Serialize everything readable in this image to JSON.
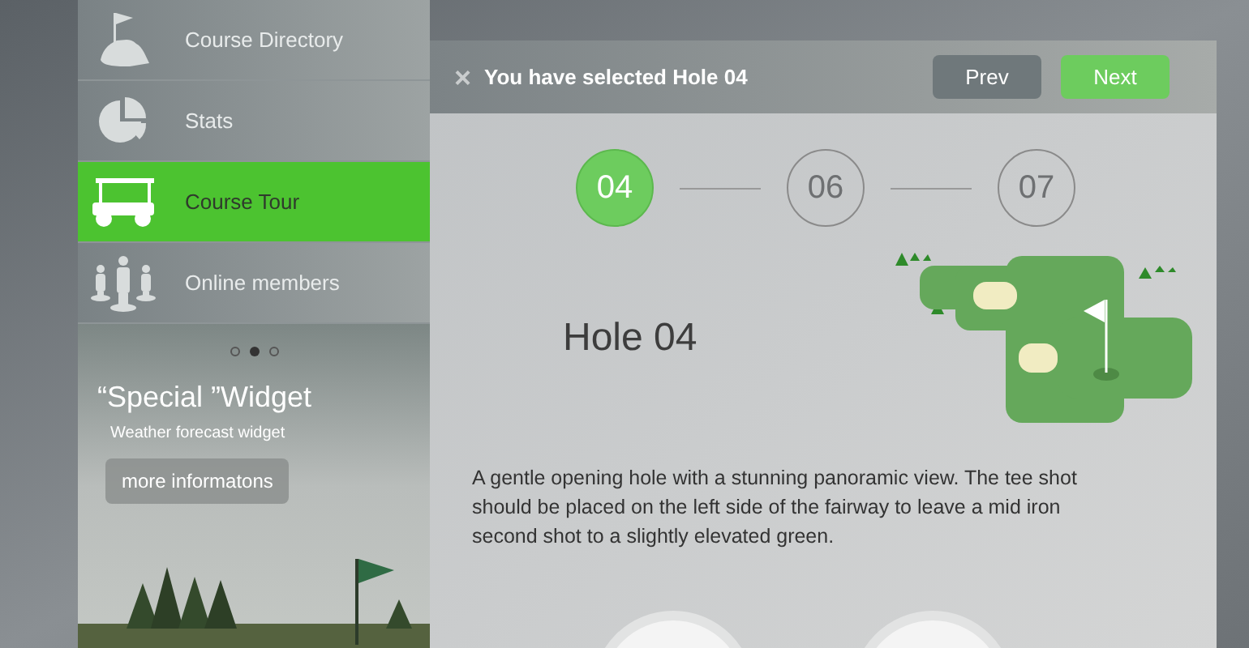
{
  "sidebar": {
    "items": [
      {
        "label": "Course Directory",
        "selected": false
      },
      {
        "label": "Stats",
        "selected": false
      },
      {
        "label": "Course Tour",
        "selected": true
      },
      {
        "label": "Online members",
        "selected": false
      }
    ]
  },
  "widget": {
    "dots": [
      {
        "selected": false
      },
      {
        "selected": true
      },
      {
        "selected": false
      }
    ],
    "title": "“Special ”Widget",
    "subtitle": "Weather forecast widget",
    "button": "more informatons"
  },
  "header": {
    "close": "×",
    "title": "You have selected Hole 04",
    "prev": "Prev",
    "next": "Next"
  },
  "steps": [
    {
      "label": "04",
      "selected": true
    },
    {
      "label": "06",
      "selected": false
    },
    {
      "label": "07",
      "selected": false
    }
  ],
  "hole": {
    "title": "Hole 04",
    "description": "A gentle opening hole with a stunning panoramic view. The tee shot should be placed on the left side of the fairway to leave a mid iron second shot to a slightly elevated green."
  }
}
